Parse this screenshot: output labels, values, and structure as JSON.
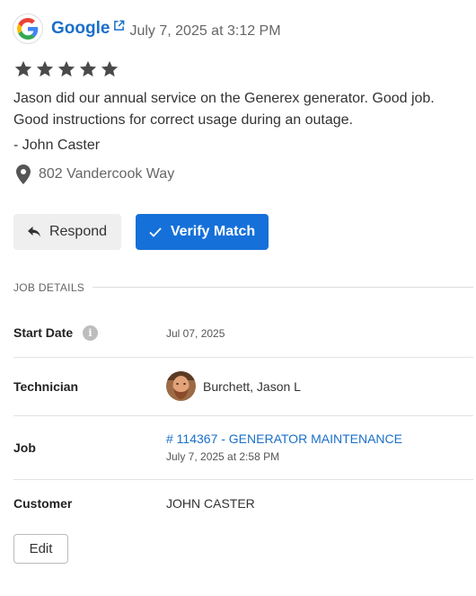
{
  "review": {
    "source_name": "Google",
    "date": "July 7, 2025 at 3:12 PM",
    "rating": 5,
    "max_rating": 5,
    "text": "Jason did our annual service on the Generex generator. Good job. Good instructions for correct usage during an outage.",
    "author": "- John Caster",
    "location": "802 Vandercook Way"
  },
  "actions": {
    "respond_label": "Respond",
    "verify_label": "Verify Match"
  },
  "job_details": {
    "section_title": "JOB DETAILS",
    "start_date_label": "Start Date",
    "start_date_value": "Jul 07, 2025",
    "technician_label": "Technician",
    "technician_name": "Burchett, Jason L",
    "job_label": "Job",
    "job_link": "# 114367 - GENERATOR MAINTENANCE",
    "job_date": "July 7, 2025 at 2:58 PM",
    "customer_label": "Customer",
    "customer_value": "JOHN CASTER",
    "edit_label": "Edit"
  },
  "colors": {
    "accent": "#1670d9",
    "link": "#1a6fc9",
    "star": "#4a4a4a"
  },
  "icons": [
    "google-logo-icon",
    "external-link-icon",
    "star-icon",
    "map-pin-icon",
    "reply-icon",
    "check-icon",
    "info-icon"
  ]
}
